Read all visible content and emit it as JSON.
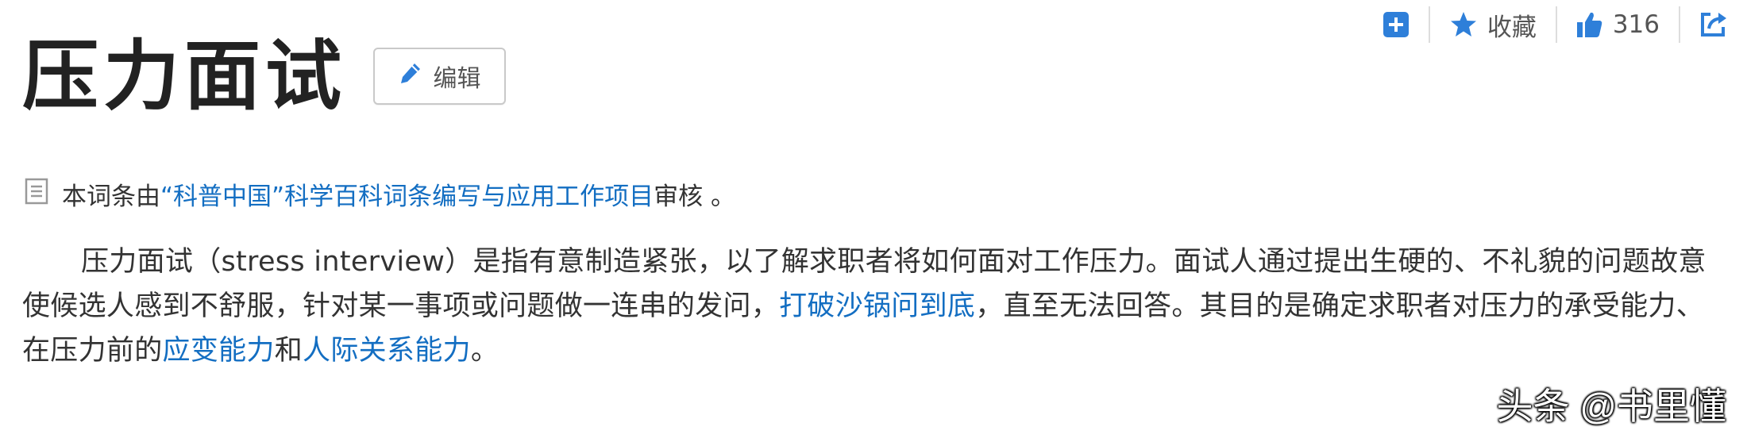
{
  "toolbar": {
    "favorite_label": "收藏",
    "like_count": "316",
    "icons": {
      "add": "plus-square-icon",
      "favorite": "star-icon",
      "like": "thumbs-up-icon",
      "share": "share-icon"
    },
    "accent_color": "#2e7fd9"
  },
  "page": {
    "title": "压力面试",
    "edit_label": "编辑"
  },
  "review": {
    "prefix": "本词条由",
    "link": "“科普中国”科学百科词条编写与应用工作项目",
    "suffix": " 审核 。"
  },
  "body": {
    "text_1": "压力面试（stress interview）是指有意制造紧张，以了解求职者将如何面对工作压力。面试人通过提出生硬的、不礼貌的问题故意使候选人感到不舒服，针对某一事项或问题做一连串的发问，",
    "link_1": "打破沙锅问到底",
    "text_2": "，直至无法回答。其目的是确定求职者对压力的承受能力、在压力前的",
    "link_2": "应变能力",
    "text_3": "和",
    "link_3": "人际关系能力",
    "text_4": "。"
  },
  "watermark": "头条 @书里懂",
  "colors": {
    "link": "#136ec2",
    "text": "#333333",
    "title": "#222222"
  }
}
